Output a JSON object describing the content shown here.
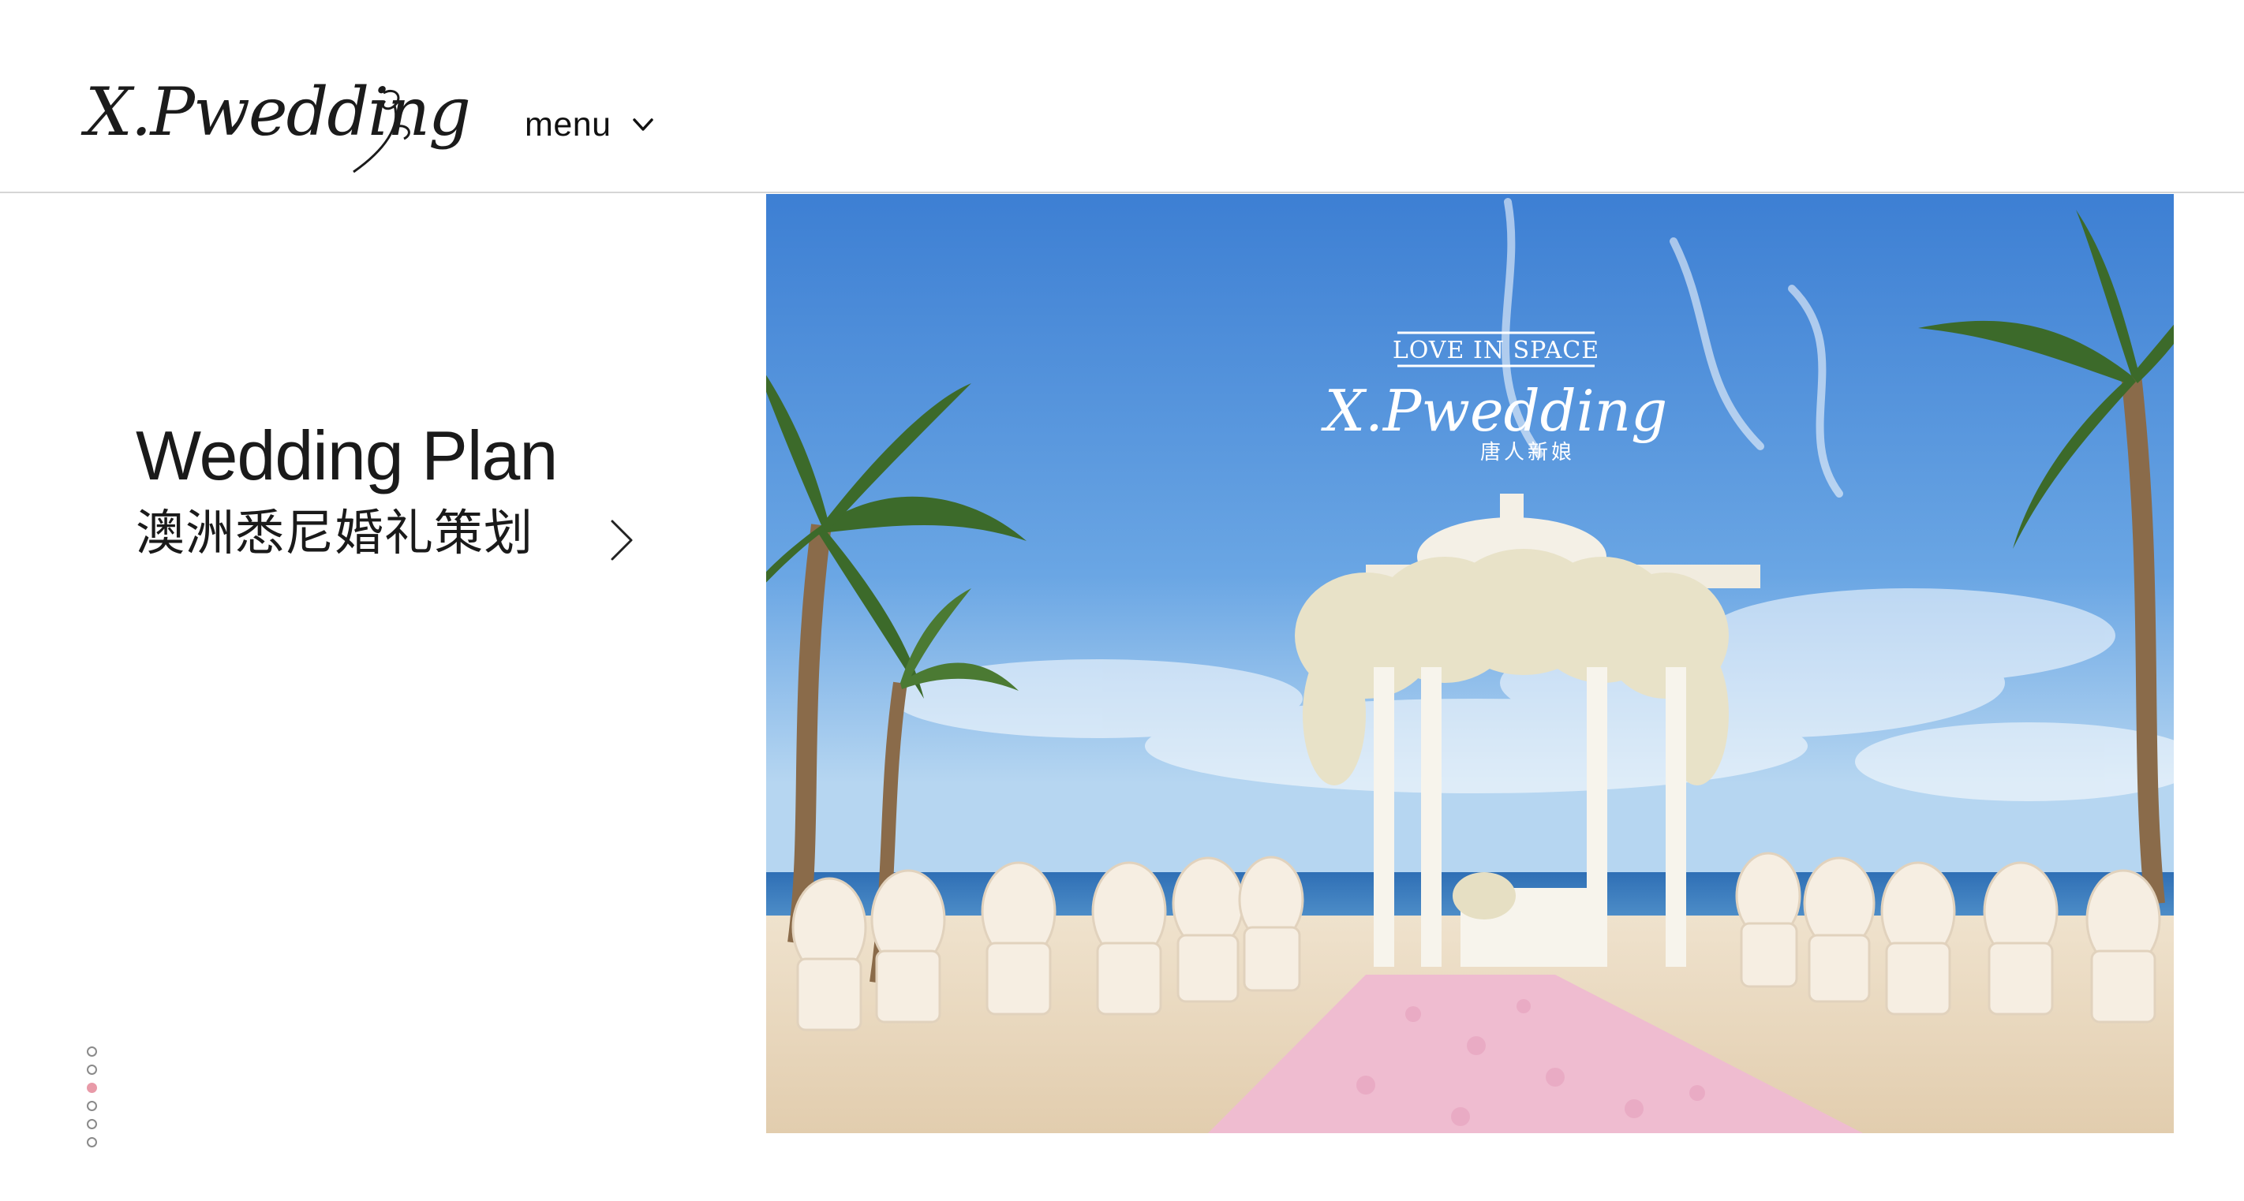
{
  "header": {
    "logo": {
      "text": "X.Pwedding",
      "icon": "xpwedding-logo"
    },
    "menu": {
      "label": "menu",
      "icon": "chevron-down-icon"
    }
  },
  "hero": {
    "title": "Wedding Plan",
    "subtitle": "澳洲悉尼婚礼策划",
    "next_icon": "chevron-right-icon"
  },
  "pager": {
    "count": 6,
    "active_index": 2
  },
  "image": {
    "description_icon": "beach-wedding-photo",
    "overlay": {
      "tagline": "LOVE IN SPACE",
      "brand": "X.Pwedding",
      "brand_cn": "唐人新娘"
    }
  },
  "colors": {
    "accent": "#e89aa8",
    "header_border": "#d6d6d6",
    "text": "#1a1a1a"
  }
}
